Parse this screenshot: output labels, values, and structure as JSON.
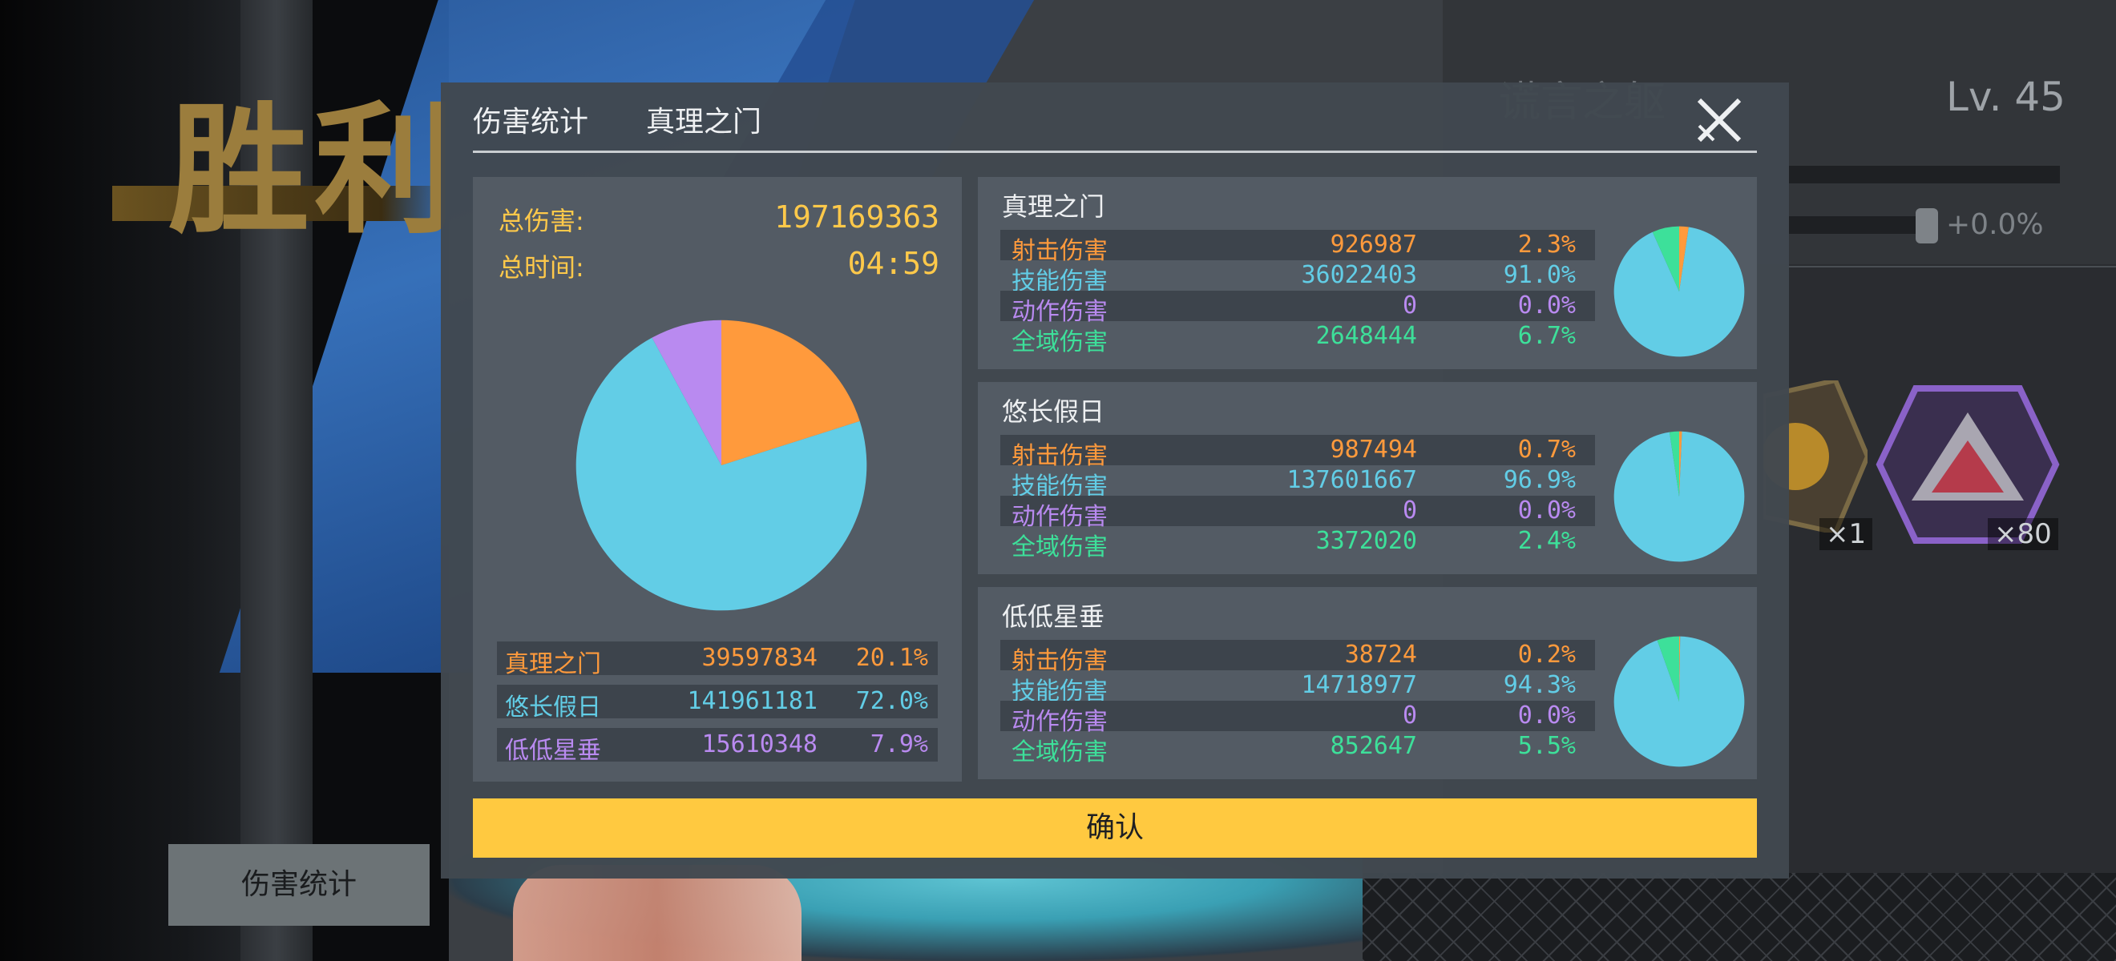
{
  "background": {
    "victory_text": "胜利",
    "right_title": "谎言之躯",
    "level": "Lv. 45",
    "bonus": "+0.0%",
    "item_counts": [
      "×1",
      "×80"
    ]
  },
  "modal": {
    "tabs": [
      "伤害统计",
      "真理之门"
    ],
    "close_icon": "close-icon",
    "total_damage_label": "总伤害:",
    "total_damage_value": "197169363",
    "total_time_label": "总时间:",
    "total_time_value": "04:59",
    "summary": [
      {
        "name": "真理之门",
        "value": "39597834",
        "percent": "20.1%",
        "color": "#ff9a3c"
      },
      {
        "name": "悠长假日",
        "value": "141961181",
        "percent": "72.0%",
        "color": "#62cde6"
      },
      {
        "name": "低低星垂",
        "value": "15610348",
        "percent": "7.9%",
        "color": "#b98af0"
      }
    ],
    "characters": [
      {
        "name": "真理之门",
        "rows": [
          {
            "label": "射击伤害",
            "value": "926987",
            "percent": "2.3%",
            "color": "#ff9a3c"
          },
          {
            "label": "技能伤害",
            "value": "36022403",
            "percent": "91.0%",
            "color": "#62cde6"
          },
          {
            "label": "动作伤害",
            "value": "0",
            "percent": "0.0%",
            "color": "#b98af0"
          },
          {
            "label": "全域伤害",
            "value": "2648444",
            "percent": "6.7%",
            "color": "#3de09a"
          }
        ]
      },
      {
        "name": "悠长假日",
        "rows": [
          {
            "label": "射击伤害",
            "value": "987494",
            "percent": "0.7%",
            "color": "#ff9a3c"
          },
          {
            "label": "技能伤害",
            "value": "137601667",
            "percent": "96.9%",
            "color": "#62cde6"
          },
          {
            "label": "动作伤害",
            "value": "0",
            "percent": "0.0%",
            "color": "#b98af0"
          },
          {
            "label": "全域伤害",
            "value": "3372020",
            "percent": "2.4%",
            "color": "#3de09a"
          }
        ]
      },
      {
        "name": "低低星垂",
        "rows": [
          {
            "label": "射击伤害",
            "value": "38724",
            "percent": "0.2%",
            "color": "#ff9a3c"
          },
          {
            "label": "技能伤害",
            "value": "14718977",
            "percent": "94.3%",
            "color": "#62cde6"
          },
          {
            "label": "动作伤害",
            "value": "0",
            "percent": "0.0%",
            "color": "#b98af0"
          },
          {
            "label": "全域伤害",
            "value": "852647",
            "percent": "5.5%",
            "color": "#3de09a"
          }
        ]
      }
    ],
    "confirm_label": "确认"
  },
  "bottom_button_label": "伤害统计",
  "chart_data": [
    {
      "type": "pie",
      "categories": [
        "真理之门",
        "悠长假日",
        "低低星垂"
      ],
      "values": [
        39597834,
        141961181,
        15610348
      ],
      "colors": [
        "#ff9a3c",
        "#62cde6",
        "#b98af0"
      ]
    },
    {
      "type": "pie",
      "title": "真理之门",
      "categories": [
        "射击伤害",
        "技能伤害",
        "动作伤害",
        "全域伤害"
      ],
      "values": [
        926987,
        36022403,
        0,
        2648444
      ],
      "colors": [
        "#ff9a3c",
        "#62cde6",
        "#b98af0",
        "#3de09a"
      ]
    },
    {
      "type": "pie",
      "title": "悠长假日",
      "categories": [
        "射击伤害",
        "技能伤害",
        "动作伤害",
        "全域伤害"
      ],
      "values": [
        987494,
        137601667,
        0,
        3372020
      ],
      "colors": [
        "#ff9a3c",
        "#62cde6",
        "#b98af0",
        "#3de09a"
      ]
    },
    {
      "type": "pie",
      "title": "低低星垂",
      "categories": [
        "射击伤害",
        "技能伤害",
        "动作伤害",
        "全域伤害"
      ],
      "values": [
        38724,
        14718977,
        0,
        852647
      ],
      "colors": [
        "#ff9a3c",
        "#62cde6",
        "#b98af0",
        "#3de09a"
      ]
    }
  ]
}
